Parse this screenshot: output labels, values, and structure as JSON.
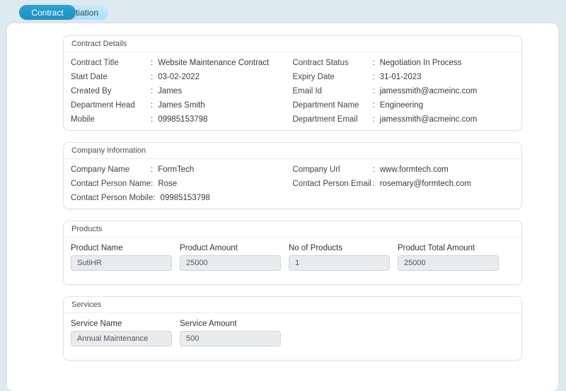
{
  "tabs": {
    "contract": {
      "label": "Contract",
      "active": true
    },
    "negotiation": {
      "label": "Negotiation",
      "active": false
    }
  },
  "contract_details": {
    "title": "Contract Details",
    "fields": {
      "contract_title": {
        "label": "Contract Title",
        "value": "Website Maintenance Contract"
      },
      "contract_status": {
        "label": "Contract Status",
        "value": "Negotiation In Process"
      },
      "start_date": {
        "label": "Start Date",
        "value": "03-02-2022"
      },
      "expiry_date": {
        "label": "Expiry Date",
        "value": "31-01-2023"
      },
      "created_by": {
        "label": "Created By",
        "value": "James"
      },
      "email_id": {
        "label": "Email Id",
        "value": "jamessmith@acmeinc.com"
      },
      "department_head": {
        "label": "Department Head",
        "value": "James Smith"
      },
      "department_name": {
        "label": "Department Name",
        "value": "Engineering"
      },
      "mobile": {
        "label": "Mobile",
        "value": "09985153798"
      },
      "department_email": {
        "label": "Department Email",
        "value": "jamessmith@acmeinc.com"
      }
    }
  },
  "company_information": {
    "title": "Company Information",
    "fields": {
      "company_name": {
        "label": "Company Name",
        "value": "FormTech"
      },
      "company_url": {
        "label": "Company Url",
        "value": "www.formtech.com"
      },
      "contact_person_name": {
        "label": "Contact Person Name",
        "value": "Rose"
      },
      "contact_person_email": {
        "label": "Contact Person Email",
        "value": "rosemary@formtech.com"
      },
      "contact_person_mobile": {
        "label": "Contact Person Mobile",
        "value": "09985153798"
      }
    }
  },
  "products": {
    "title": "Products",
    "fields": {
      "product_name": {
        "label": "Product Name",
        "value": "SutiHR"
      },
      "product_amount": {
        "label": "Product Amount",
        "value": "25000"
      },
      "no_of_products": {
        "label": "No of Products",
        "value": "1"
      },
      "product_total_amount": {
        "label": "Product Total Amount",
        "value": "25000"
      }
    }
  },
  "services": {
    "title": "Services",
    "fields": {
      "service_name": {
        "label": "Service Name",
        "value": "Annual Maintenance"
      },
      "service_amount": {
        "label": "Service Amount",
        "value": "500"
      }
    }
  },
  "colors": {
    "active_tab": "#2196c8",
    "inactive_tab": "#b4e4f8",
    "page_background": "#dfe9f0"
  }
}
